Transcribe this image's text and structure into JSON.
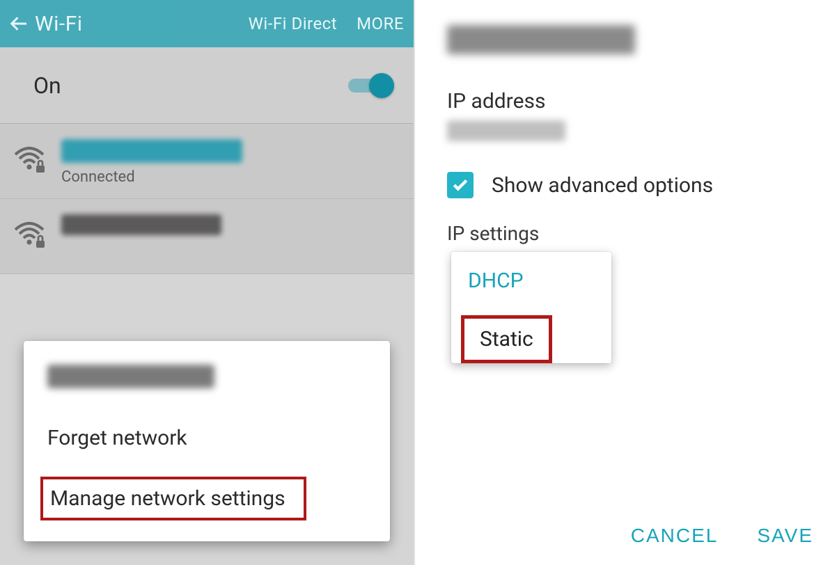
{
  "left": {
    "header": {
      "title": "Wi-Fi",
      "action_direct": "Wi-Fi Direct",
      "action_more": "MORE"
    },
    "toggle": {
      "label": "On",
      "state": true
    },
    "networks": [
      {
        "status": "Connected"
      },
      {
        "status": ""
      }
    ],
    "popup": {
      "forget_label": "Forget network",
      "manage_label": "Manage network settings"
    }
  },
  "right": {
    "ip_address_label": "IP address",
    "advanced": {
      "checked": true,
      "label": "Show advanced options"
    },
    "ip_settings_label": "IP settings",
    "dropdown": {
      "option_dhcp": "DHCP",
      "option_static": "Static"
    },
    "buttons": {
      "cancel": "CANCEL",
      "save": "SAVE"
    }
  }
}
